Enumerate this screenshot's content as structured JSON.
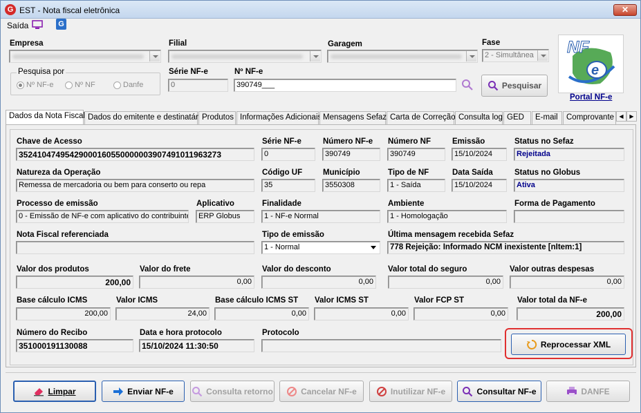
{
  "window": {
    "title": "EST - Nota fiscal eletrônica"
  },
  "toolbar": {
    "saida_label": "Saída"
  },
  "header": {
    "empresa_label": "Empresa",
    "filial_label": "Filial",
    "garagem_label": "Garagem",
    "fase_label": "Fase",
    "fase_value": "2 - Simultânea",
    "pesquisa_label": "Pesquisa por",
    "radios": [
      "Nº NF-e",
      "Nº NF",
      "Danfe"
    ],
    "serie_label": "Série NF-e",
    "serie_value": "0",
    "numero_label": "Nº NF-e",
    "numero_value": "390749___",
    "pesquisar_label": "Pesquisar",
    "portal_label": "Portal NF-e"
  },
  "tabs": [
    "Dados da Nota Fiscal",
    "Dados do emitente e destinatário",
    "Produtos",
    "Informações Adicionais",
    "Mensagens Sefaz",
    "Carta de Correção",
    "Consulta log",
    "GED",
    "E-mail",
    "Comprovante d"
  ],
  "form": {
    "chave_label": "Chave de Acesso",
    "chave_value": "35241047495429000160550000003907491011963273",
    "serie_label": "Série NF-e",
    "serie_value": "0",
    "numero_nfe_label": "Número NF-e",
    "numero_nfe_value": "390749",
    "numero_nf_label": "Número NF",
    "numero_nf_value": "390749",
    "emissao_label": "Emissão",
    "emissao_value": "15/10/2024",
    "status_sefaz_label": "Status no Sefaz",
    "status_sefaz_value": "Rejeitada",
    "natureza_label": "Natureza da Operação",
    "natureza_value": "Remessa de mercadoria ou bem para conserto ou repa",
    "codigo_uf_label": "Código UF",
    "codigo_uf_value": "35",
    "municipio_label": "Município",
    "municipio_value": "3550308",
    "tipo_nf_label": "Tipo de NF",
    "tipo_nf_value": "1 - Saída",
    "data_saida_label": "Data Saída",
    "data_saida_value": "15/10/2024",
    "status_globus_label": "Status no Globus",
    "status_globus_value": "Ativa",
    "processo_label": "Processo de emissão",
    "processo_value": "0 - Emissão de NF-e com aplicativo do contribuinte",
    "aplicativo_label": "Aplicativo",
    "aplicativo_value": "ERP Globus",
    "finalidade_label": "Finalidade",
    "finalidade_value": "1 - NF-e Normal",
    "ambiente_label": "Ambiente",
    "ambiente_value": "1 - Homologação",
    "forma_pag_label": "Forma de Pagamento",
    "forma_pag_value": "",
    "nf_ref_label": "Nota Fiscal referenciada",
    "nf_ref_value": "",
    "tipo_emissao_label": "Tipo de emissão",
    "tipo_emissao_value": "1 - Normal",
    "ultima_msg_label": "Última mensagem recebida Sefaz",
    "ultima_msg_value": "778 Rejeição: Informado NCM inexistente [nItem:1]",
    "valor_produtos_label": "Valor dos produtos",
    "valor_produtos_value": "200,00",
    "valor_frete_label": "Valor do frete",
    "valor_frete_value": "0,00",
    "valor_desconto_label": "Valor do desconto",
    "valor_desconto_value": "0,00",
    "valor_seguro_label": "Valor total do seguro",
    "valor_seguro_value": "0,00",
    "valor_outras_label": "Valor outras despesas",
    "valor_outras_value": "0,00",
    "base_icms_label": "Base cálculo ICMS",
    "base_icms_value": "200,00",
    "valor_icms_label": "Valor ICMS",
    "valor_icms_value": "24,00",
    "base_icms_st_label": "Base cálculo ICMS ST",
    "base_icms_st_value": "0,00",
    "valor_icms_st_label": "Valor ICMS ST",
    "valor_icms_st_value": "0,00",
    "valor_fcp_st_label": "Valor FCP ST",
    "valor_fcp_st_value": "0,00",
    "valor_total_label": "Valor total da NF-e",
    "valor_total_value": "200,00",
    "recibo_label": "Número do Recibo",
    "recibo_value": "351000191130088",
    "data_protocolo_label": "Data e hora protocolo",
    "data_protocolo_value": "15/10/2024 11:30:50",
    "protocolo_label": "Protocolo",
    "protocolo_value": "",
    "reprocessar_label": "Reprocessar XML"
  },
  "footer": {
    "limpar": "Limpar",
    "enviar": "Enviar NF-e",
    "consulta_retorno": "Consulta retorno",
    "cancelar": "Cancelar NF-e",
    "inutilizar": "Inutilizar NF-e",
    "consultar": "Consultar NF-e",
    "danfe": "DANFE"
  },
  "colors": {
    "highlight": "#e03030",
    "link": "#00008b",
    "accent": "#2a6fc9"
  }
}
